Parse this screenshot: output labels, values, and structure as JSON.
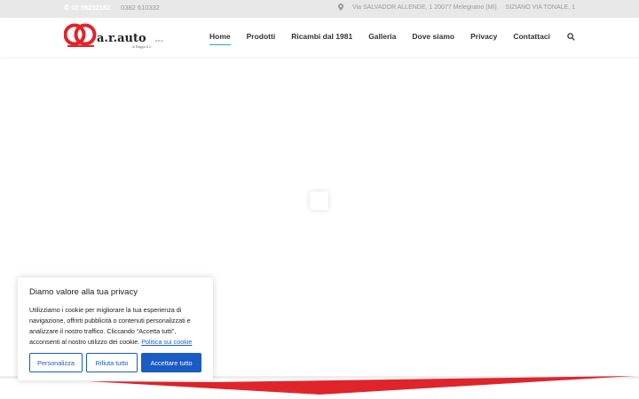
{
  "topbar": {
    "phone1": "02 98232182",
    "phone2": "0382 610332",
    "address1": "Via SALVADOR ALLENDE, 1 20077 Melegnano (MI)",
    "address2": "SIZIANO VIA TONALE, 1"
  },
  "logo": {
    "main": "a.r.auto",
    "suffix": "s.n.c.",
    "sub": "di Raggio & C."
  },
  "nav": {
    "items": [
      "Home",
      "Prodotti",
      "Ricambi dal 1981",
      "Galleria",
      "Dove siamo",
      "Privacy",
      "Contattaci"
    ],
    "active": "Home"
  },
  "colors": {
    "accent": "#2aa3c9",
    "brand_red": "#e0242b",
    "button_blue": "#1a5bc4"
  },
  "cookie": {
    "title": "Diamo valore alla tua privacy",
    "body": "Utilizziamo i cookie per migliorare la tua esperienza di navigazione, offrirti pubblicità o contenuti personalizzati e analizzare il nostro traffico. Cliccando “Accetta tutti”, acconsenti al nostro utilizzo dei cookie.",
    "link": "Politica sui cookie",
    "btn_customize": "Personalizza",
    "btn_reject": "Rifiuta tutto",
    "btn_accept": "Accettare tutto"
  }
}
